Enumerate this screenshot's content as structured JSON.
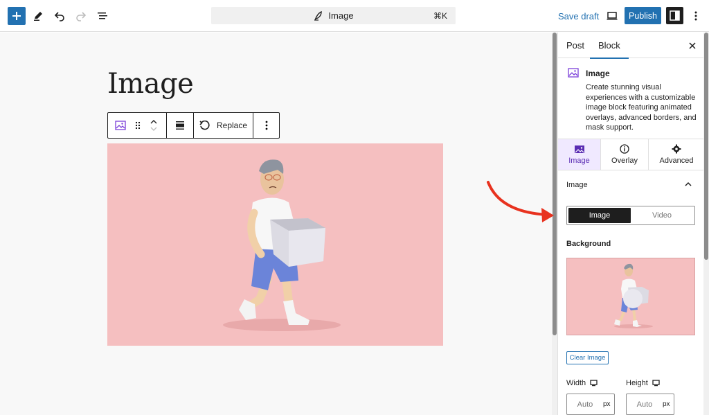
{
  "topbar": {
    "command_title": "Image",
    "command_shortcut": "⌘K",
    "save_draft": "Save draft",
    "publish": "Publish"
  },
  "editor": {
    "post_title": "Image",
    "toolbar": {
      "replace_label": "Replace"
    }
  },
  "sidebar": {
    "tabs": [
      {
        "label": "Post"
      },
      {
        "label": "Block"
      }
    ],
    "active_tab": "Block",
    "block_card": {
      "title": "Image",
      "description": "Create stunning visual experiences with a customizable image block featuring animated overlays, advanced borders, and mask support."
    },
    "sub_tabs": [
      {
        "label": "Image",
        "icon": "image-icon"
      },
      {
        "label": "Overlay",
        "icon": "info-icon"
      },
      {
        "label": "Advanced",
        "icon": "gear-icon"
      }
    ],
    "active_sub_tab": "Image",
    "panel": {
      "title": "Image",
      "segmented": [
        {
          "label": "Image"
        },
        {
          "label": "Video"
        }
      ],
      "segmented_selected": "Image",
      "background_label": "Background",
      "clear_image": "Clear Image",
      "width_label": "Width",
      "height_label": "Height",
      "width_placeholder": "Auto",
      "height_placeholder": "Auto",
      "unit": "px"
    }
  },
  "colors": {
    "accent": "#2271b1",
    "image_bg": "#f5bfc0",
    "active_subtab_bg": "#f0e9ff",
    "annotation_arrow": "#e8321f"
  }
}
